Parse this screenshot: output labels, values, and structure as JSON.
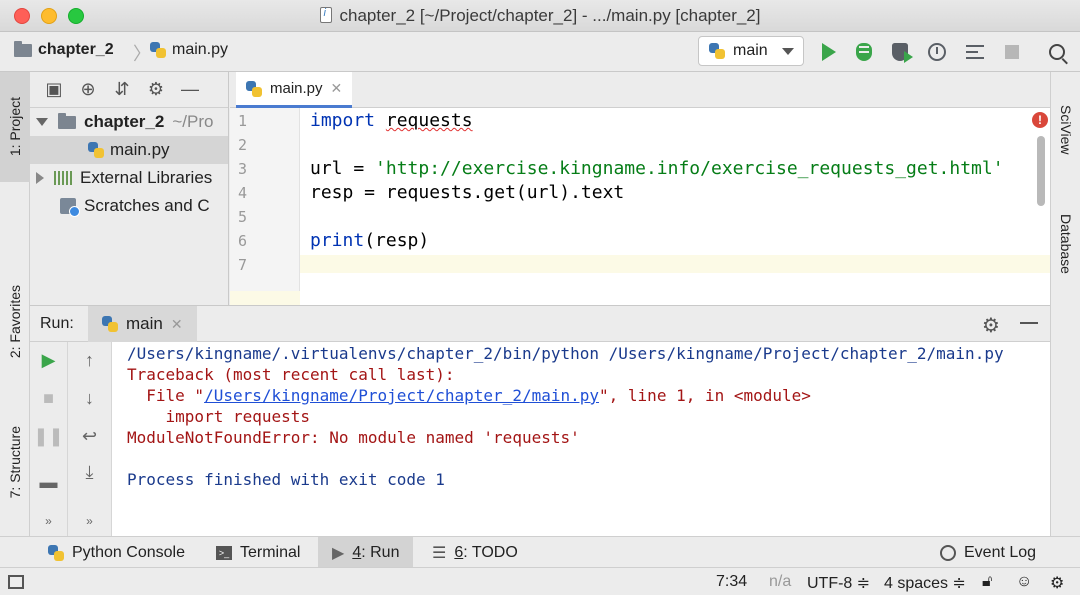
{
  "window": {
    "title": "chapter_2 [~/Project/chapter_2] - .../main.py [chapter_2]"
  },
  "breadcrumb": {
    "project": "chapter_2",
    "file": "main.py"
  },
  "toolbar": {
    "run_config": "main"
  },
  "left_strip": {
    "project_tab": "1: Project",
    "favorites_tab": "2: Favorites",
    "structure_tab": "7: Structure"
  },
  "right_strip": {
    "sciview_tab": "SciView",
    "database_tab": "Database"
  },
  "project_tree": {
    "root_name": "chapter_2",
    "root_path": "~/Pro",
    "file": "main.py",
    "external_libraries": "External Libraries",
    "scratches": "Scratches and C"
  },
  "editor": {
    "tab": "main.py",
    "line_numbers": [
      "1",
      "2",
      "3",
      "4",
      "5",
      "6",
      "7"
    ],
    "line1_kw": "import",
    "line1_mod": "requests",
    "line3_prefix": "url = ",
    "line3_str": "'http://exercise.kingname.info/exercise_requests_get.html'",
    "line4": "resp = requests.get(url).text",
    "line6_kw": "print",
    "line6_rest": "(resp)"
  },
  "run": {
    "label": "Run:",
    "tab": "main",
    "console": {
      "cmd": "/Users/kingname/.virtualenvs/chapter_2/bin/python /Users/kingname/Project/chapter_2/main.py",
      "traceback": "Traceback (most recent call last):",
      "file_prefix": "  File \"",
      "file_link": "/Users/kingname/Project/chapter_2/main.py",
      "file_suffix": "\", line 1, in <module>",
      "import_line": "    import requests",
      "error": "ModuleNotFoundError: No module named 'requests'",
      "finished": "Process finished with exit code 1"
    }
  },
  "tool_windows": {
    "python_console": "Python Console",
    "terminal": "Terminal",
    "run_num": "4",
    "run_label": ": Run",
    "todo_num": "6",
    "todo_label": ": TODO",
    "event_log": "Event Log"
  },
  "status": {
    "position": "7:34",
    "na": "n/a",
    "encoding": "UTF-8 ≑",
    "indent": "4 spaces ≑"
  }
}
